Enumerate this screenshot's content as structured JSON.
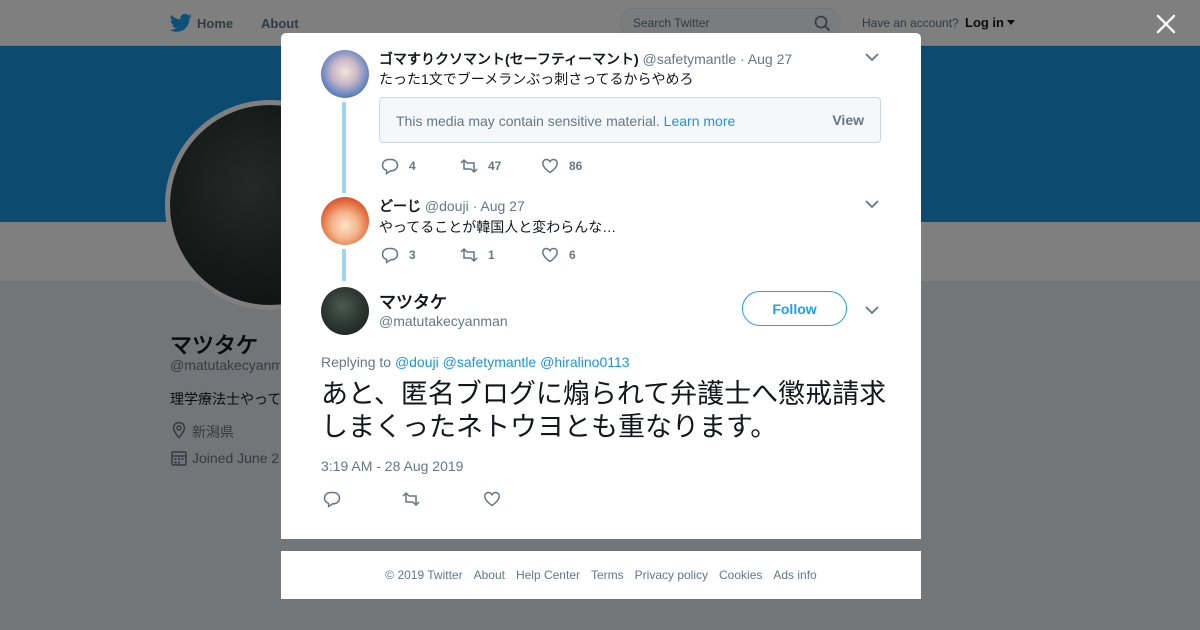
{
  "colors": {
    "brand": "#1da1f2",
    "link": "#1b95e0",
    "banner": "#1b95e0",
    "muted": "#657786",
    "thread_line": "#9fd4f1"
  },
  "topbar": {
    "home_label": "Home",
    "about_label": "About",
    "search_placeholder": "Search Twitter",
    "have_account": "Have an account?",
    "login_label": "Log in"
  },
  "profile": {
    "name": "マツタケ",
    "handle": "@matutakecyanman",
    "bio": "理学療法士やって",
    "location": "新潟県",
    "joined": "Joined June 2"
  },
  "thread": [
    {
      "name": "ゴマすりクソマント(セーフティーマント)",
      "handle": "@safetymantle",
      "date": "· Aug 27",
      "text": "たった1文でブーメランぶっ刺さってるからやめろ",
      "sensitive": {
        "message": "This media may contain sensitive material.",
        "learn_more": "Learn more",
        "view": "View"
      },
      "replies": "4",
      "retweets": "47",
      "likes": "86"
    },
    {
      "name": "どーじ",
      "handle": "@douji",
      "date": "· Aug 27",
      "text": "やってることが韓国人と変わらんな…",
      "replies": "3",
      "retweets": "1",
      "likes": "6"
    }
  ],
  "main_tweet": {
    "name": "マツタケ",
    "handle": "@matutakecyanman",
    "follow_label": "Follow",
    "replying_prefix": "Replying to",
    "replying_to": [
      "@douji",
      "@safetymantle",
      "@hiralino0113"
    ],
    "text": "あと、匿名ブログに煽られて弁護士へ懲戒請求しまくったネトウヨとも重なります。",
    "timestamp": "3:19 AM - 28 Aug 2019"
  },
  "footer": [
    "© 2019 Twitter",
    "About",
    "Help Center",
    "Terms",
    "Privacy policy",
    "Cookies",
    "Ads info"
  ]
}
